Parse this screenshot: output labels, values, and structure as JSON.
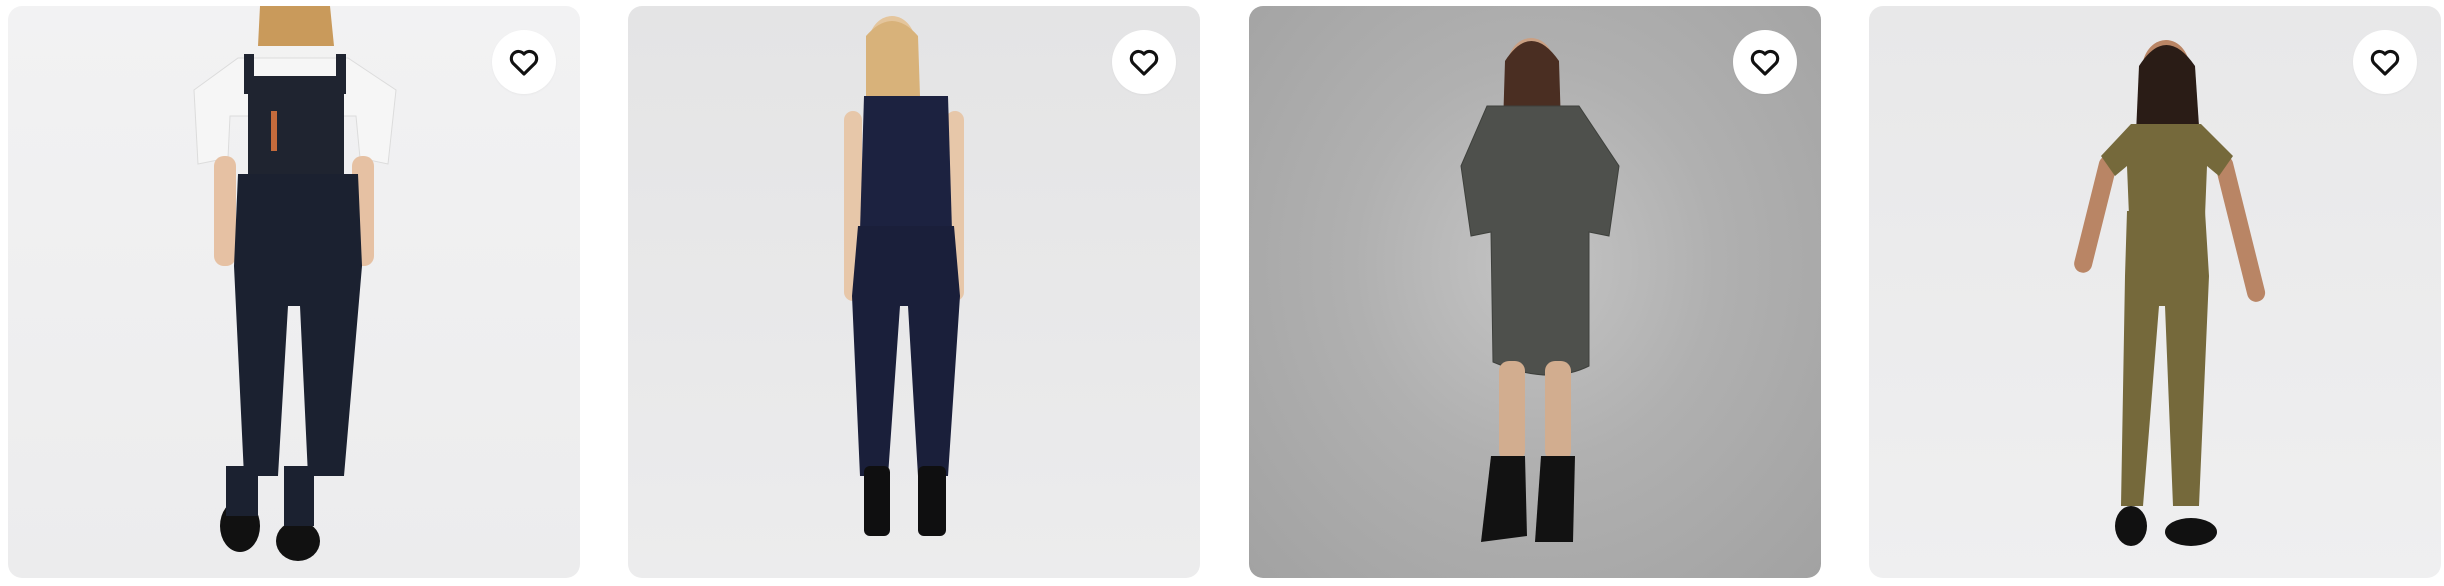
{
  "products": [
    {
      "image_alt": "",
      "favorite_icon": "heart-outline-icon"
    },
    {
      "image_alt": "",
      "favorite_icon": "heart-outline-icon"
    },
    {
      "image_alt": "",
      "favorite_icon": "heart-outline-icon"
    },
    {
      "image_alt": "",
      "favorite_icon": "heart-outline-icon"
    }
  ],
  "colors": {
    "icon": "#111111",
    "button_bg": "#ffffff"
  }
}
